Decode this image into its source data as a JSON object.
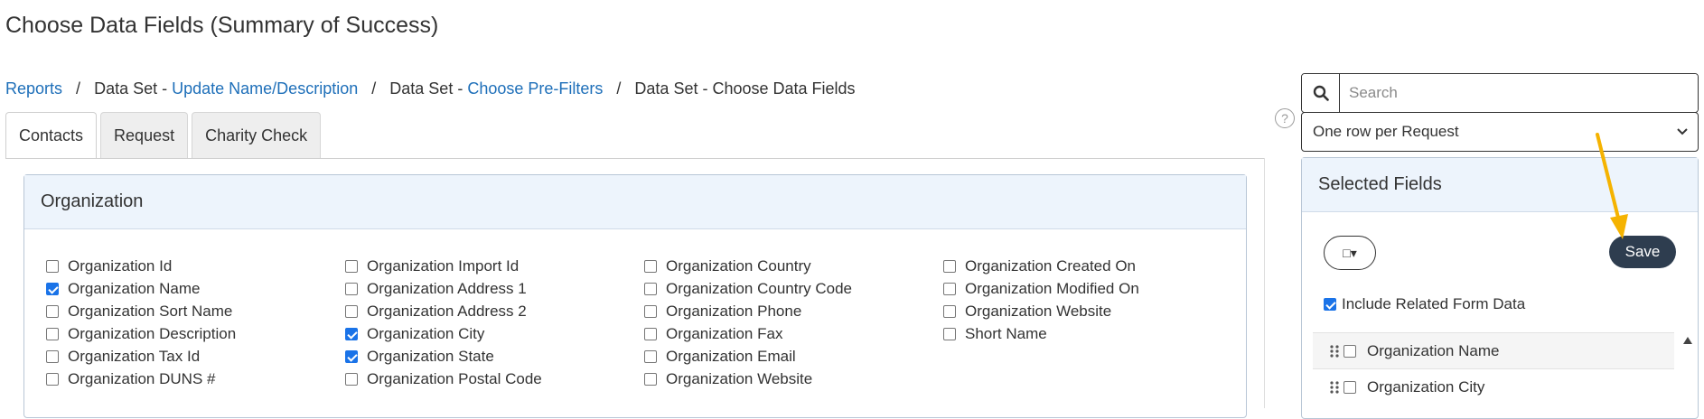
{
  "page": {
    "title": "Choose Data Fields (Summary of Success)"
  },
  "breadcrumb": {
    "reports": "Reports",
    "ds1_prefix": "Data Set - ",
    "ds1_link": "Update Name/Description",
    "ds2_prefix": "Data Set - ",
    "ds2_link": "Choose Pre-Filters",
    "current": "Data Set - Choose Data Fields",
    "separator": "/"
  },
  "tabs": [
    {
      "label": "Contacts",
      "active": true
    },
    {
      "label": "Request",
      "active": false
    },
    {
      "label": "Charity Check",
      "active": false
    }
  ],
  "organization": {
    "heading": "Organization",
    "columns": [
      [
        {
          "label": "Organization Id",
          "checked": false
        },
        {
          "label": "Organization Name",
          "checked": true
        },
        {
          "label": "Organization Sort Name",
          "checked": false
        },
        {
          "label": "Organization Description",
          "checked": false
        },
        {
          "label": "Organization Tax Id",
          "checked": false
        },
        {
          "label": "Organization DUNS #",
          "checked": false
        }
      ],
      [
        {
          "label": "Organization Import Id",
          "checked": false
        },
        {
          "label": "Organization Address 1",
          "checked": false
        },
        {
          "label": "Organization Address 2",
          "checked": false
        },
        {
          "label": "Organization City",
          "checked": true
        },
        {
          "label": "Organization State",
          "checked": true
        },
        {
          "label": "Organization Postal Code",
          "checked": false
        }
      ],
      [
        {
          "label": "Organization Country",
          "checked": false
        },
        {
          "label": "Organization Country Code",
          "checked": false
        },
        {
          "label": "Organization Phone",
          "checked": false
        },
        {
          "label": "Organization Fax",
          "checked": false
        },
        {
          "label": "Organization Email",
          "checked": false
        },
        {
          "label": "Organization Website",
          "checked": false
        }
      ],
      [
        {
          "label": "Organization Created On",
          "checked": false
        },
        {
          "label": "Organization Modified On",
          "checked": false
        },
        {
          "label": "Organization Website",
          "checked": false
        },
        {
          "label": "Short Name",
          "checked": false
        }
      ]
    ]
  },
  "search": {
    "placeholder": "Search",
    "value": "",
    "icon": "search-icon"
  },
  "row_select": {
    "value": "One row per Request",
    "icon": "chevron-down-icon"
  },
  "help": {
    "glyph": "?"
  },
  "selected_fields": {
    "heading": "Selected Fields",
    "save_label": "Save",
    "view_toggle_icon": "□▾",
    "include_related_label": "Include Related Form Data",
    "include_related_checked": true,
    "items": [
      {
        "label": "Organization Name",
        "checked": false
      },
      {
        "label": "Organization City",
        "checked": false
      }
    ]
  },
  "colors": {
    "link": "#1e6fb9",
    "panel_header": "#edf4fc",
    "checkbox_checked": "#1a73e8",
    "save_button": "#2e3d4f",
    "annotation_arrow": "#f5b301"
  }
}
